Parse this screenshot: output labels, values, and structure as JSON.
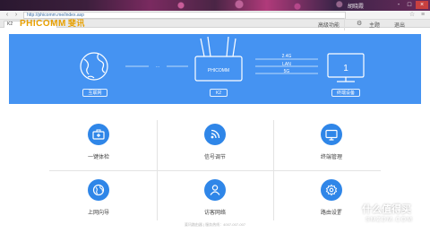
{
  "browser": {
    "title_user": "胡晓霞",
    "url": "http://phicomm.me/index.asp",
    "tab_label": "K2",
    "window_controls": [
      "-",
      "□",
      "×"
    ]
  },
  "header": {
    "logo": "PHICOMM",
    "logo_cn": "斐讯",
    "nav": [
      "高级功能",
      "主题",
      "退出"
    ]
  },
  "banner": {
    "bg_color": "#4593f2",
    "internet_label": "互联网",
    "router_label": "K2",
    "router_brand": "PHICOMM",
    "devices_label": "终端设备",
    "device_count": "1",
    "bands": [
      "2.4G",
      "LAN",
      "5G"
    ]
  },
  "functions": [
    {
      "label": "一键体检",
      "icon": "first-aid-kit-icon"
    },
    {
      "label": "信号调节",
      "icon": "wifi-signal-icon"
    },
    {
      "label": "终端管理",
      "icon": "monitor-icon"
    },
    {
      "label": "上网向导",
      "icon": "globe-icon"
    },
    {
      "label": "访客网络",
      "icon": "guest-user-icon"
    },
    {
      "label": "路由设置",
      "icon": "settings-gear-icon"
    }
  ],
  "footer": "斐讯路由器 | 服务热线：4007-007-007",
  "watermark": {
    "line1": "什么值得买",
    "line2": "SMZDM.COM",
    "logo": "值"
  }
}
